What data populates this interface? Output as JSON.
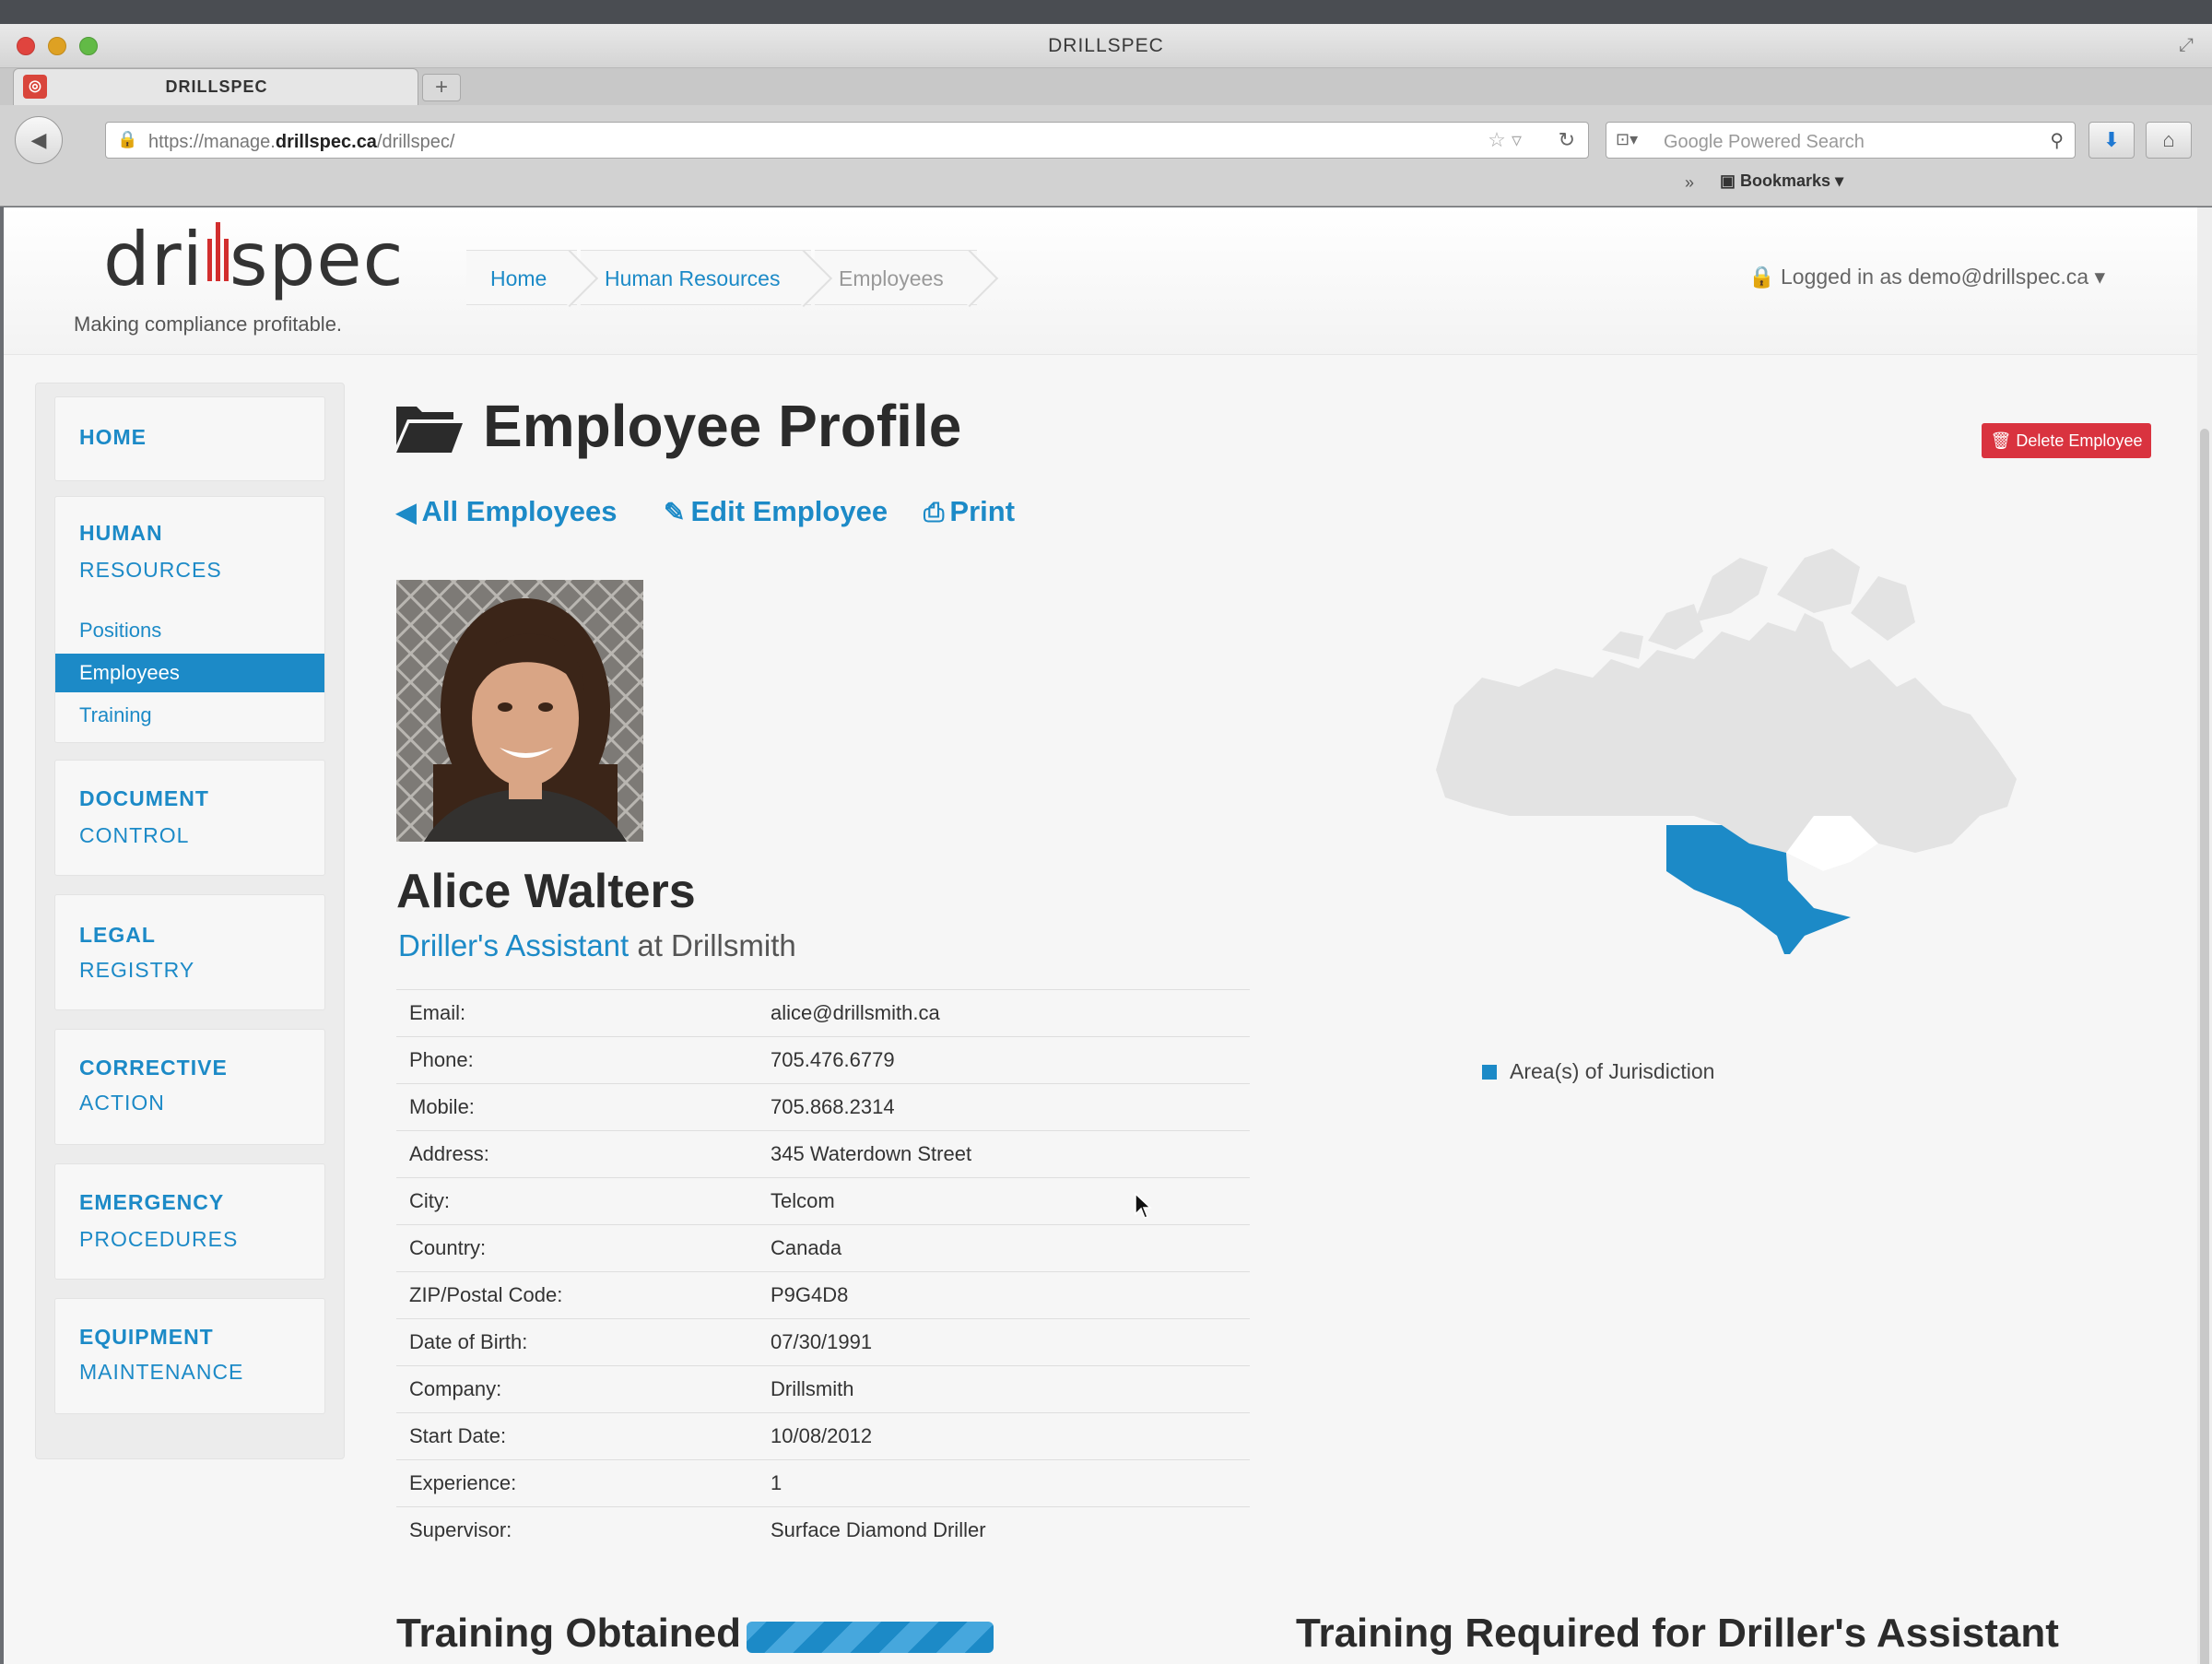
{
  "browser": {
    "window_title": "DRILLSPEC",
    "tab_title": "DRILLSPEC",
    "new_tab_label": "+",
    "url_prefix": "https://manage.",
    "url_domain": "drillspec.ca",
    "url_path": "/drillspec/",
    "search_placeholder": "Google Powered Search",
    "bookmarks_label": "Bookmarks",
    "bookmarks_chevron": "»"
  },
  "header": {
    "logo_left": "dri",
    "logo_right": "spec",
    "tagline": "Making compliance profitable.",
    "breadcrumb": [
      "Home",
      "Human Resources",
      "Employees"
    ],
    "login": "Logged in as demo@drillspec.ca"
  },
  "sidebar": {
    "home": "HOME",
    "hr_title": "HUMAN",
    "hr_sub": "RESOURCES",
    "hr_items": [
      "Positions",
      "Employees",
      "Training"
    ],
    "doc_title": "DOCUMENT",
    "doc_sub": "CONTROL",
    "legal_title": "LEGAL",
    "legal_sub": "REGISTRY",
    "corrective_title": "CORRECTIVE",
    "corrective_sub": "ACTION",
    "emergency_title": "EMERGENCY",
    "emergency_sub": "PROCEDURES",
    "equipment_title": "EQUIPMENT",
    "equipment_sub": "MAINTENANCE"
  },
  "main": {
    "title": "Employee Profile",
    "delete_button": "Delete Employee",
    "actions": {
      "all": "All Employees",
      "edit": "Edit Employee",
      "print": "Print"
    },
    "employee": {
      "name": "Alice Walters",
      "role": "Driller's Assistant",
      "at_company": " at Drillsmith"
    },
    "details": [
      {
        "label": "Email:",
        "value": "alice@drillsmith.ca"
      },
      {
        "label": "Phone:",
        "value": "705.476.6779"
      },
      {
        "label": "Mobile:",
        "value": "705.868.2314"
      },
      {
        "label": "Address:",
        "value": "345 Waterdown Street"
      },
      {
        "label": "City:",
        "value": "Telcom"
      },
      {
        "label": "Country:",
        "value": "Canada"
      },
      {
        "label": "ZIP/Postal Code:",
        "value": "P9G4D8"
      },
      {
        "label": "Date of Birth:",
        "value": "07/30/1991"
      },
      {
        "label": "Company:",
        "value": "Drillsmith"
      },
      {
        "label": "Start Date:",
        "value": "10/08/2012"
      },
      {
        "label": "Experience:",
        "value": "1"
      },
      {
        "label": "Supervisor:",
        "value": "Surface Diamond Driller"
      }
    ],
    "map_legend": "Area(s) of Jurisdiction",
    "training_obtained": "Training Obtained",
    "training_progress": 1.0,
    "training_required": "Training Required for Driller's Assistant"
  },
  "colors": {
    "accent": "#1c8ac7",
    "danger": "#d9333f",
    "logo_red": "#d22e2e",
    "map_land": "#e3e3e3"
  }
}
